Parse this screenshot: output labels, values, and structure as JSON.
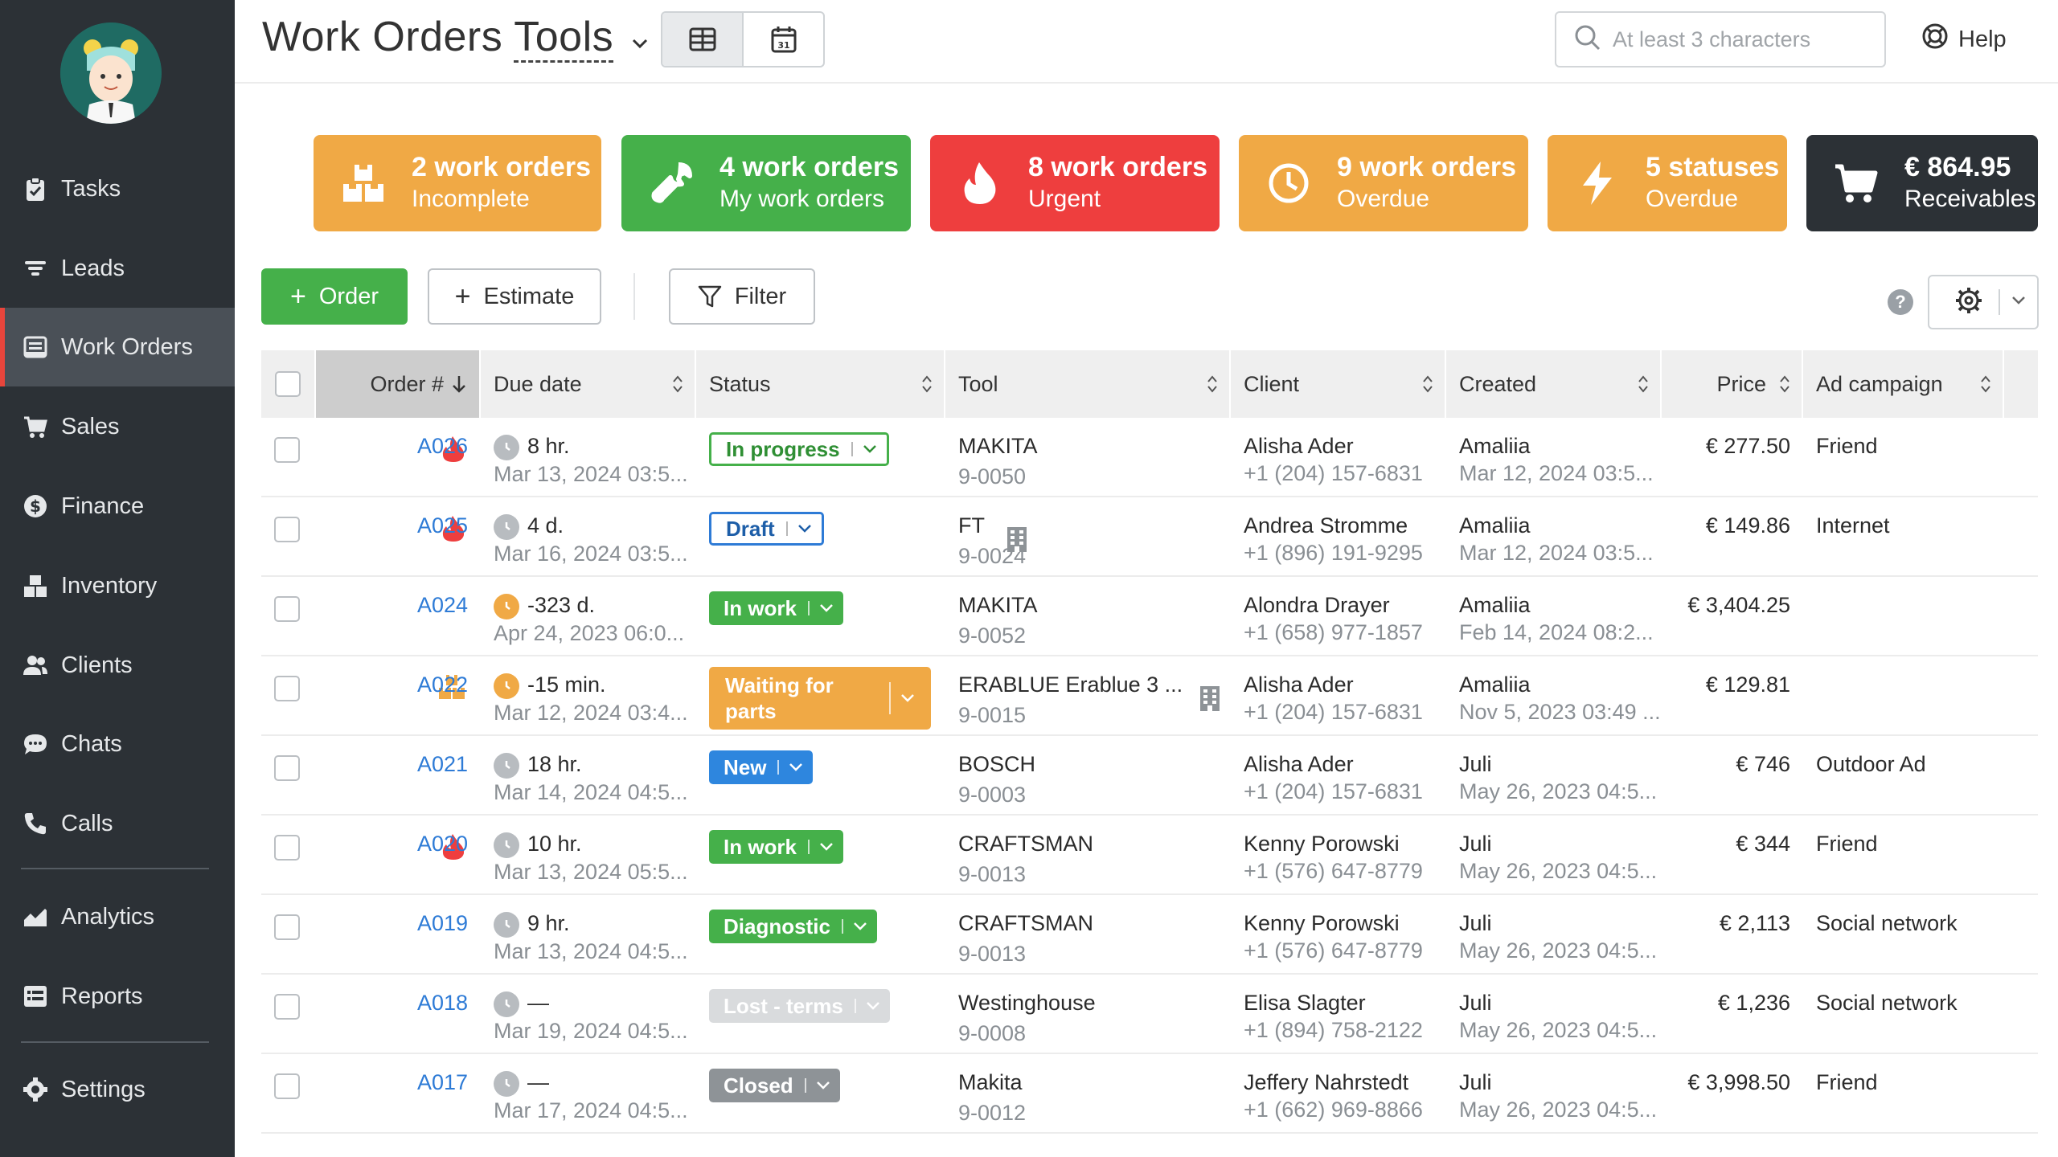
{
  "sidebar": {
    "items": [
      {
        "label": "Tasks",
        "icon": "clipboard-icon"
      },
      {
        "label": "Leads",
        "icon": "filter-lines-icon"
      },
      {
        "label": "Work Orders",
        "icon": "work-orders-icon",
        "active": true
      },
      {
        "label": "Sales",
        "icon": "cart-icon"
      },
      {
        "label": "Finance",
        "icon": "dollar-icon"
      },
      {
        "label": "Inventory",
        "icon": "boxes-icon"
      },
      {
        "label": "Clients",
        "icon": "users-icon"
      },
      {
        "label": "Chats",
        "icon": "chat-icon"
      },
      {
        "label": "Calls",
        "icon": "phone-icon"
      },
      {
        "label": "Analytics",
        "icon": "chart-icon"
      },
      {
        "label": "Reports",
        "icon": "reports-icon"
      },
      {
        "label": "Settings",
        "icon": "gear-icon"
      }
    ]
  },
  "header": {
    "title_part1": "Work Orders ",
    "title_part2": "Tools",
    "search_placeholder": "At least 3 characters",
    "help_label": "Help"
  },
  "cards": [
    {
      "title": "2 work orders",
      "subtitle": "Incomplete",
      "color": "#f0a945",
      "icon": "boxes-icon"
    },
    {
      "title": "4 work orders",
      "subtitle": "My work orders",
      "color": "#45b04a",
      "icon": "wrench-icon"
    },
    {
      "title": "8 work orders",
      "subtitle": "Urgent",
      "color": "#ee3e3e",
      "icon": "flame-icon"
    },
    {
      "title": "9 work orders",
      "subtitle": "Overdue",
      "color": "#f0a945",
      "icon": "clock-icon"
    },
    {
      "title": "5 statuses",
      "subtitle": "Overdue",
      "color": "#f0a945",
      "icon": "bolt-icon"
    },
    {
      "title": "€ 864.95",
      "subtitle": "Receivables",
      "color": "#2c3136",
      "icon": "cart-icon"
    }
  ],
  "toolbar": {
    "order_label": "Order",
    "estimate_label": "Estimate",
    "filter_label": "Filter",
    "help_mark": "?"
  },
  "table": {
    "columns": [
      "Order #",
      "Due date",
      "Status",
      "Tool",
      "Client",
      "Created",
      "Price",
      "Ad campaign"
    ],
    "rows": [
      {
        "flag": "urgent",
        "order": "A026",
        "due_main": "8 hr.",
        "due_sub": "Mar 13, 2024 03:5...",
        "due_state": "normal",
        "status": "In progress",
        "status_style": "outline-green",
        "tool": "MAKITA",
        "tool_sub": "9-0050",
        "tool_building": false,
        "client": "Alisha Ader",
        "client_phone": "+1 (204) 157-6831",
        "created_by": "Amaliia",
        "created_at": "Mar 12, 2024 03:5...",
        "price": "€ 277.50",
        "campaign": "Friend"
      },
      {
        "flag": "urgent",
        "order": "A025",
        "due_main": "4 d.",
        "due_sub": "Mar 16, 2024 03:5...",
        "due_state": "normal",
        "status": "Draft",
        "status_style": "outline-blue",
        "tool": "FT",
        "tool_sub": "9-0024",
        "tool_building": true,
        "client": "Andrea Stromme",
        "client_phone": "+1 (896) 191-9295",
        "created_by": "Amaliia",
        "created_at": "Mar 12, 2024 03:5...",
        "price": "€ 149.86",
        "campaign": "Internet"
      },
      {
        "flag": "",
        "order": "A024",
        "due_main": "-323 d.",
        "due_sub": "Apr 24, 2023 06:0...",
        "due_state": "overdue",
        "status": "In work",
        "status_style": "green",
        "tool": "MAKITA",
        "tool_sub": "9-0052",
        "tool_building": false,
        "client": "Alondra Drayer",
        "client_phone": "+1 (658) 977-1857",
        "created_by": "Amaliia",
        "created_at": "Feb 14, 2024 08:2...",
        "price": "€ 3,404.25",
        "campaign": ""
      },
      {
        "flag": "incomplete",
        "order": "A022",
        "due_main": "-15 min.",
        "due_sub": "Mar 12, 2024 03:4...",
        "due_state": "overdue",
        "status": "Waiting for parts",
        "status_style": "orange",
        "tool": "ERABLUE Erablue 3 ...",
        "tool_sub": "9-0015",
        "tool_building": true,
        "client": "Alisha Ader",
        "client_phone": "+1 (204) 157-6831",
        "created_by": "Amaliia",
        "created_at": "Nov 5, 2023 03:49 ...",
        "price": "€ 129.81",
        "campaign": ""
      },
      {
        "flag": "",
        "order": "A021",
        "due_main": "18 hr.",
        "due_sub": "Mar 14, 2024 04:5...",
        "due_state": "normal",
        "status": "New",
        "status_style": "blue",
        "tool": "BOSCH",
        "tool_sub": "9-0003",
        "tool_building": false,
        "client": "Alisha Ader",
        "client_phone": "+1 (204) 157-6831",
        "created_by": "Juli",
        "created_at": "May 26, 2023 04:5...",
        "price": "€ 746",
        "campaign": "Outdoor Ad"
      },
      {
        "flag": "urgent",
        "order": "A020",
        "due_main": "10 hr.",
        "due_sub": "Mar 13, 2024 05:5...",
        "due_state": "normal",
        "status": "In work",
        "status_style": "green",
        "tool": "CRAFTSMAN",
        "tool_sub": "9-0013",
        "tool_building": false,
        "client": "Kenny Porowski",
        "client_phone": "+1 (576) 647-8779",
        "created_by": "Juli",
        "created_at": "May 26, 2023 04:5...",
        "price": "€ 344",
        "campaign": "Friend"
      },
      {
        "flag": "",
        "order": "A019",
        "due_main": "9 hr.",
        "due_sub": "Mar 13, 2024 04:5...",
        "due_state": "normal",
        "status": "Diagnostic",
        "status_style": "green",
        "tool": "CRAFTSMAN",
        "tool_sub": "9-0013",
        "tool_building": false,
        "client": "Kenny Porowski",
        "client_phone": "+1 (576) 647-8779",
        "created_by": "Juli",
        "created_at": "May 26, 2023 04:5...",
        "price": "€ 2,113",
        "campaign": "Social network"
      },
      {
        "flag": "",
        "order": "A018",
        "due_main": "—",
        "due_sub": "Mar 19, 2024 04:5...",
        "due_state": "normal",
        "status": "Lost - terms",
        "status_style": "light-gray",
        "tool": "Westinghouse",
        "tool_sub": "9-0008",
        "tool_building": false,
        "client": "Elisa Slagter",
        "client_phone": "+1 (894) 758-2122",
        "created_by": "Juli",
        "created_at": "May 26, 2023 04:5...",
        "price": "€ 1,236",
        "campaign": "Social network"
      },
      {
        "flag": "",
        "order": "A017",
        "due_main": "—",
        "due_sub": "Mar 17, 2024 04:5...",
        "due_state": "normal",
        "status": "Closed",
        "status_style": "gray",
        "tool": "Makita",
        "tool_sub": "9-0012",
        "tool_building": false,
        "client": "Jeffery Nahrstedt",
        "client_phone": "+1 (662) 969-8866",
        "created_by": "Juli",
        "created_at": "May 26, 2023 04:5...",
        "price": "€ 3,998.50",
        "campaign": "Friend"
      }
    ]
  },
  "colors": {
    "sidebar_bg": "#2c3136",
    "accent_red": "#e8453c",
    "link_blue": "#2e7bd6",
    "green": "#45b04a",
    "orange": "#f0a945"
  }
}
